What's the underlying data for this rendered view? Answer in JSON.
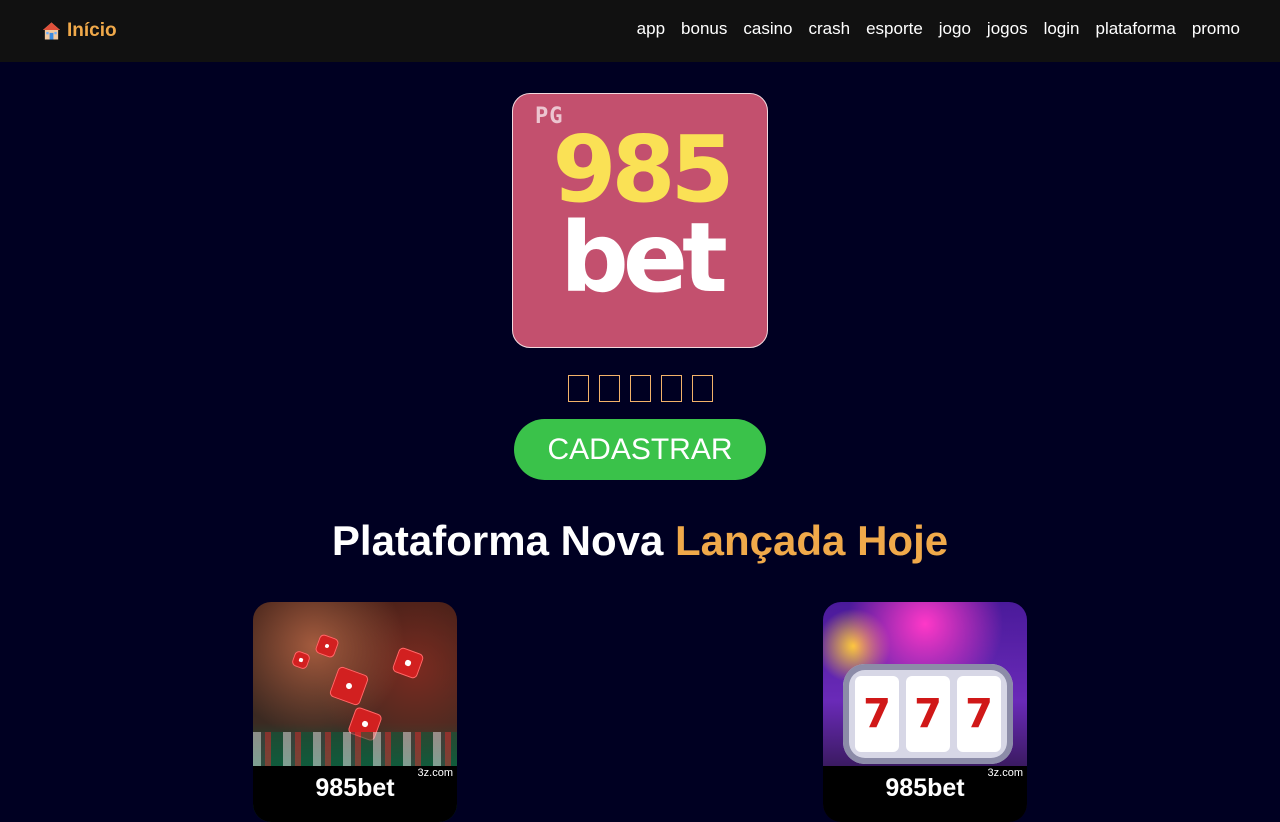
{
  "header": {
    "home_label": "Início",
    "nav": [
      "app",
      "bonus",
      "casino",
      "crash",
      "esporte",
      "jogo",
      "jogos",
      "login",
      "plataforma",
      "promo"
    ]
  },
  "logo": {
    "pg": "PG",
    "number": "985",
    "word": "bet"
  },
  "rating": {
    "stars": 5
  },
  "cta": {
    "label": "CADASTRAR"
  },
  "headline": {
    "part1": "Plataforma Nova",
    "part2": "Lançada Hoje"
  },
  "cards": [
    {
      "brand": "985bet",
      "domain": "3z.com",
      "theme": "dice"
    },
    {
      "brand": "985bet",
      "domain": "3z.com",
      "theme": "slot"
    }
  ],
  "slot_reels": [
    "7",
    "7",
    "7"
  ],
  "colors": {
    "background": "#000022",
    "topbar": "#111111",
    "accent_orange": "#f0a94a",
    "cta_green": "#3ac24a",
    "logo_pink": "#c3506e",
    "logo_yellow": "#fae155"
  }
}
